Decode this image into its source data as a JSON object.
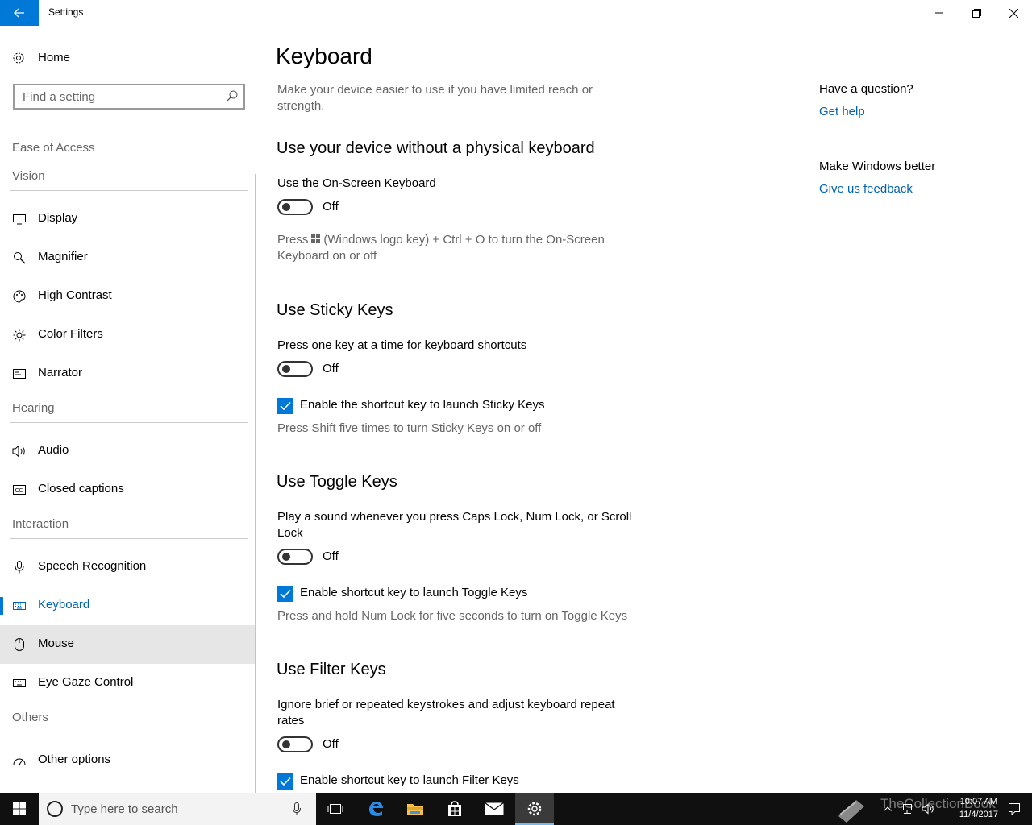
{
  "window": {
    "title": "Settings"
  },
  "sidebar": {
    "home_label": "Home",
    "search_placeholder": "Find a setting",
    "category": "Ease of Access",
    "groups": {
      "vision": "Vision",
      "hearing": "Hearing",
      "interaction": "Interaction",
      "others": "Others"
    },
    "items": {
      "display": "Display",
      "magnifier": "Magnifier",
      "high_contrast": "High Contrast",
      "color_filters": "Color Filters",
      "narrator": "Narrator",
      "audio": "Audio",
      "closed_captions": "Closed captions",
      "speech_recognition": "Speech Recognition",
      "keyboard": "Keyboard",
      "mouse": "Mouse",
      "eye_gaze": "Eye Gaze Control",
      "other_options": "Other options"
    },
    "selected": "Keyboard",
    "accent_color": "#0078d7"
  },
  "main": {
    "title": "Keyboard",
    "description": "Make your device easier to use if you have limited reach or strength.",
    "osk": {
      "heading": "Use your device without a physical keyboard",
      "label": "Use the On-Screen Keyboard",
      "state": "Off",
      "hint_before": "Press",
      "hint_after": "(Windows logo key) + Ctrl + O to turn the On-Screen Keyboard on or off"
    },
    "sticky": {
      "heading": "Use Sticky Keys",
      "label": "Press one key at a time for keyboard shortcuts",
      "state": "Off",
      "checkbox_label": "Enable the shortcut key to launch Sticky Keys",
      "checked": true,
      "hint": "Press Shift five times to turn Sticky Keys on or off"
    },
    "toggle_keys": {
      "heading": "Use Toggle Keys",
      "label": "Play a sound whenever you press Caps Lock, Num Lock, or Scroll Lock",
      "state": "Off",
      "checkbox_label": "Enable shortcut key to launch Toggle Keys",
      "checked": true,
      "hint": "Press and hold Num Lock for five seconds to turn on Toggle Keys"
    },
    "filter": {
      "heading": "Use Filter Keys",
      "label": "Ignore brief or repeated keystrokes and adjust keyboard repeat rates",
      "state": "Off",
      "checkbox_label": "Enable shortcut key to launch Filter Keys",
      "checked": true
    }
  },
  "aside": {
    "question": "Have a question?",
    "get_help": "Get help",
    "improve": "Make Windows better",
    "feedback": "Give us feedback"
  },
  "taskbar": {
    "search_placeholder": "Type here to search",
    "time": "10:07 AM",
    "date": "11/4/2017",
    "watermark": "TheCollectionBook",
    "icons": [
      "start-icon",
      "cortana-icon",
      "mic-icon",
      "task-view-icon",
      "edge-icon",
      "file-explorer-icon",
      "store-icon",
      "mail-icon",
      "settings-icon"
    ]
  }
}
